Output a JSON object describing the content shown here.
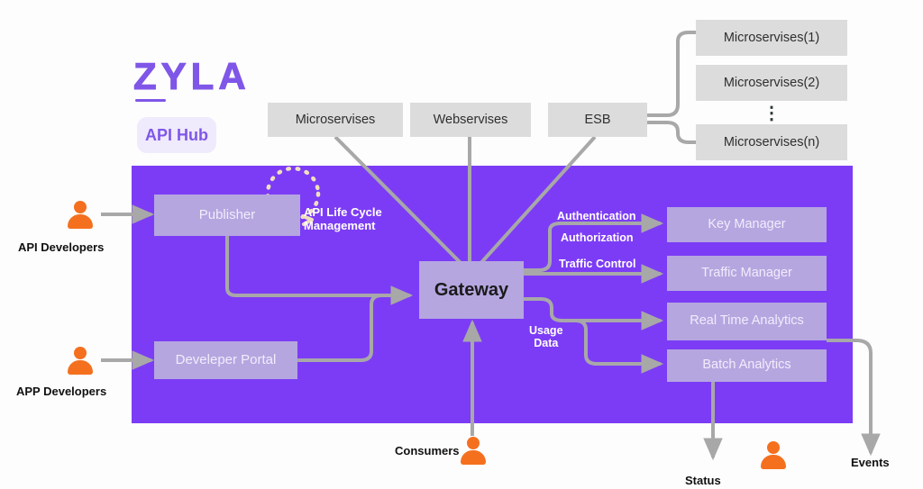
{
  "logo": {
    "brand": "ZYLA",
    "badge": "API Hub"
  },
  "external_services": {
    "microservises": "Microservises",
    "webservises": "Webservises",
    "esb": "ESB",
    "microservise_1": "Microservises(1)",
    "microservise_2": "Microservises(2)",
    "microservise_n": "Microservises(n)",
    "ellipsis": "⋮"
  },
  "platform": {
    "publisher": "Publisher",
    "developer_portal": "Develeper\nPortal",
    "gateway": "Gateway",
    "key_manager": "Key Manager",
    "traffic_manager": "Traffic Manager",
    "real_time_analytics": "Real Time\nAnalytics",
    "batch_analytics": "Batch Analytics"
  },
  "flow_labels": {
    "api_life_cycle": "API Life Cycle\nManagement",
    "authentication": "Authentication",
    "authorization": "Authorization",
    "traffic_control": "Traffic Control",
    "usage_data": "Usage\nData"
  },
  "actors": {
    "api_developers": "API Developers",
    "app_developers": "APP Developers",
    "consumers": "Consumers"
  },
  "outputs": {
    "status": "Status",
    "events": "Events"
  },
  "colors": {
    "panel_purple": "#7c3cf5",
    "inner_lavender": "#b5a6e0",
    "grey_box": "#dcdcdc",
    "brand_purple": "#7f56e8",
    "badge_bg": "#efeafc",
    "person_orange": "#f4701f",
    "connector_grey": "#a8a8a8",
    "lifecycle_dots": "#efe0bd"
  }
}
